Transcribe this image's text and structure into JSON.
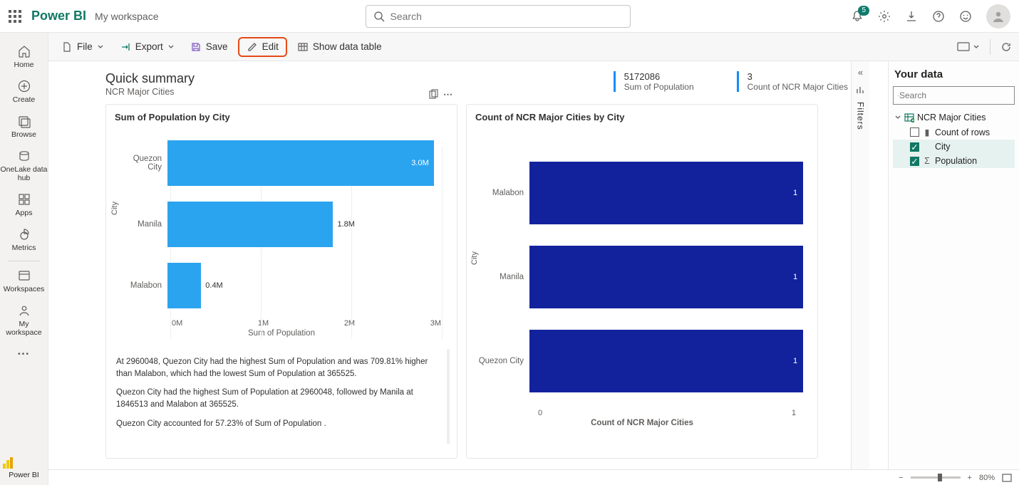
{
  "header": {
    "brand": "Power BI",
    "workspace": "My workspace",
    "search_placeholder": "Search",
    "notification_count": "5"
  },
  "leftrail": {
    "items": [
      "Home",
      "Create",
      "Browse",
      "OneLake data hub",
      "Apps",
      "Metrics",
      "Workspaces",
      "My workspace"
    ],
    "bottom": "Power BI"
  },
  "toolbar": {
    "file": "File",
    "export": "Export",
    "save": "Save",
    "edit": "Edit",
    "show_table": "Show data table"
  },
  "summary": {
    "title": "Quick summary",
    "subtitle": "NCR Major Cities",
    "kpis": [
      {
        "value": "5172086",
        "label": "Sum of Population"
      },
      {
        "value": "3",
        "label": "Count of NCR Major Cities"
      }
    ]
  },
  "chart_data": [
    {
      "type": "bar",
      "orientation": "horizontal",
      "title": "Sum of Population by City",
      "ylabel": "City",
      "xlabel": "Sum of Population",
      "categories": [
        "Quezon City",
        "Manila",
        "Malabon"
      ],
      "values": [
        2960048,
        1846513,
        365525
      ],
      "value_labels": [
        "3.0M",
        "1.8M",
        "0.4M"
      ],
      "xticks": [
        "0M",
        "1M",
        "2M",
        "3M"
      ],
      "xlim": [
        0,
        3000000
      ],
      "color": "#2ba4ef",
      "insights": [
        "At 2960048, Quezon City had the highest Sum of Population  and was 709.81% higher than Malabon, which had the lowest Sum of Population  at 365525.",
        "Quezon City had the highest Sum of Population  at 2960048, followed by Manila at 1846513 and Malabon at 365525.",
        "Quezon City accounted for 57.23% of Sum of Population ."
      ]
    },
    {
      "type": "bar",
      "orientation": "horizontal",
      "title": "Count of NCR Major Cities by City",
      "ylabel": "City",
      "xlabel": "Count of NCR Major Cities",
      "categories": [
        "Malabon",
        "Manila",
        "Quezon City"
      ],
      "values": [
        1,
        1,
        1
      ],
      "value_labels": [
        "1",
        "1",
        "1"
      ],
      "xticks": [
        "0",
        "1"
      ],
      "xlim": [
        0,
        1
      ],
      "color": "#12229d"
    }
  ],
  "sidetab": {
    "label": "Filters"
  },
  "datapane": {
    "title": "Your data",
    "search_placeholder": "Search",
    "table": "NCR Major Cities",
    "fields": [
      {
        "name": "Count of rows",
        "checked": false,
        "measure": true
      },
      {
        "name": "City",
        "checked": true,
        "measure": false
      },
      {
        "name": "Population",
        "checked": true,
        "measure": true,
        "sigma": true
      }
    ]
  },
  "status": {
    "zoom": "80%"
  }
}
